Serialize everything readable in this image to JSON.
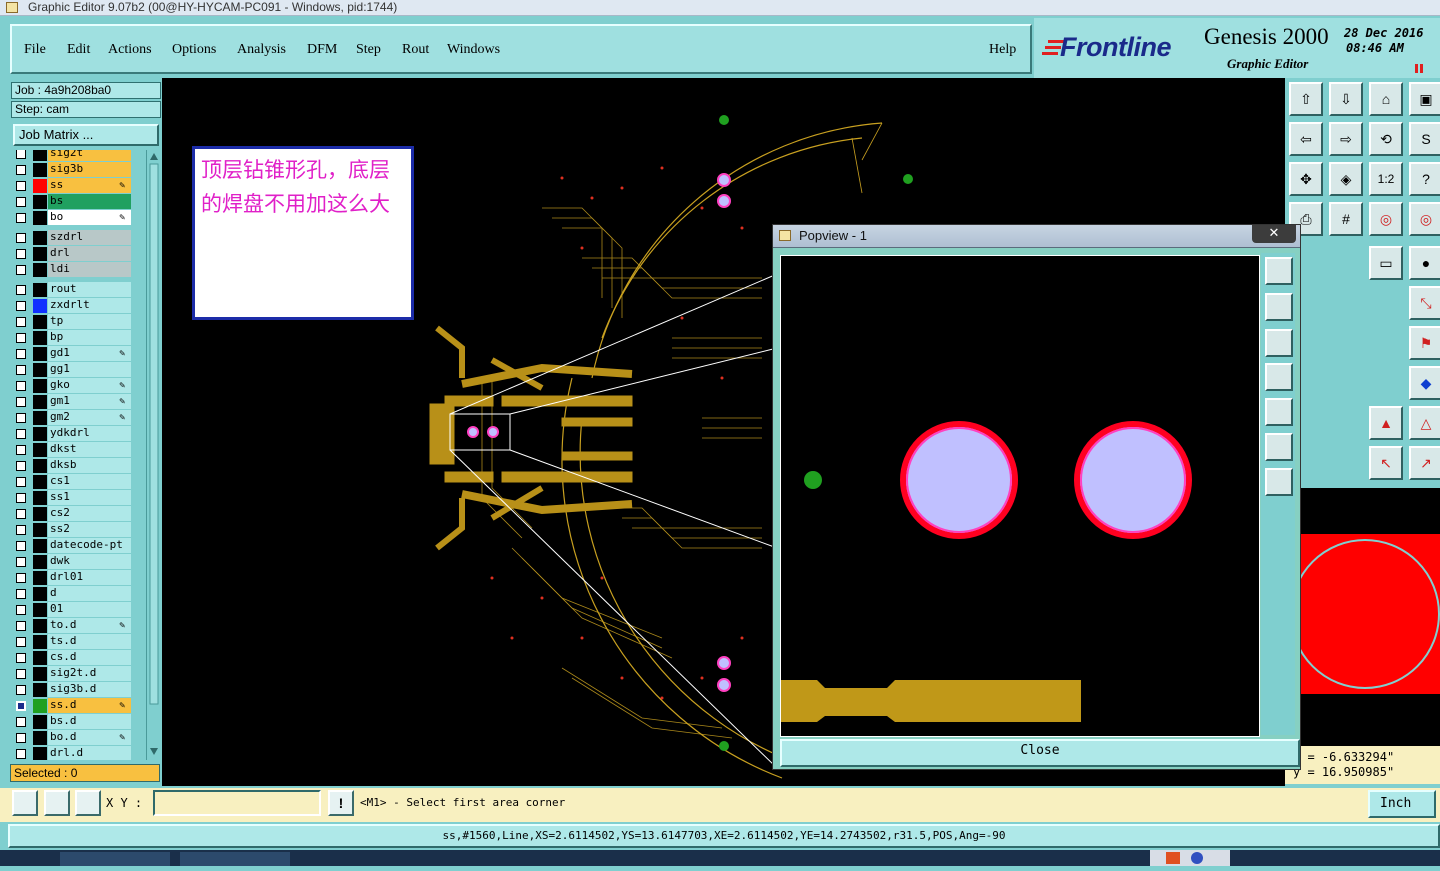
{
  "window": {
    "title": "Graphic Editor 9.07b2 (00@HY-HYCAM-PC091 - Windows, pid:1744)"
  },
  "menu": [
    "File",
    "Edit",
    "Actions",
    "Options",
    "Analysis",
    "DFM",
    "Step",
    "Rout",
    "Windows"
  ],
  "help_label": "Help",
  "brand": {
    "logo": "Frontline",
    "product": "Genesis 2000",
    "subtitle": "Graphic Editor",
    "date": "28 Dec 2016",
    "time": "08:46 AM"
  },
  "job": {
    "job_label": "Job : 4a9h208ba0",
    "step_label": "Step: cam",
    "matrix_button": "Job Matrix ..."
  },
  "layers": [
    {
      "name": "sig2t",
      "color": "#f8c040",
      "swatch": "#000000",
      "checked": false
    },
    {
      "name": "sig3b",
      "color": "#f8c040",
      "swatch": "#000000",
      "checked": false
    },
    {
      "name": "ss",
      "color": "#f8c040",
      "swatch": "#ff0000",
      "checked": false,
      "pen": true
    },
    {
      "name": "bs",
      "color": "#20a060",
      "swatch": "#000000",
      "checked": false
    },
    {
      "name": "bo",
      "color": "#ffffff",
      "swatch": "#000000",
      "checked": false,
      "pen": true
    },
    {
      "name": "szdrl",
      "color": "#b8c8c8",
      "swatch": "#000000",
      "checked": false,
      "gap": true
    },
    {
      "name": "drl",
      "color": "#b8c8c8",
      "swatch": "#000000",
      "checked": false
    },
    {
      "name": "ldi",
      "color": "#b8c8c8",
      "swatch": "#000000",
      "checked": false
    },
    {
      "name": "rout",
      "color": "#aee8e8",
      "swatch": "#000000",
      "checked": false,
      "gap": true
    },
    {
      "name": "zxdrlt",
      "color": "#aee8e8",
      "swatch": "#1030ff",
      "checked": false
    },
    {
      "name": "tp",
      "color": "#aee8e8",
      "swatch": "#000000",
      "checked": false
    },
    {
      "name": "bp",
      "color": "#aee8e8",
      "swatch": "#000000",
      "checked": false
    },
    {
      "name": "gd1",
      "color": "#aee8e8",
      "swatch": "#000000",
      "checked": false,
      "pen": true
    },
    {
      "name": "gg1",
      "color": "#aee8e8",
      "swatch": "#000000",
      "checked": false
    },
    {
      "name": "gko",
      "color": "#aee8e8",
      "swatch": "#000000",
      "checked": false,
      "pen": true
    },
    {
      "name": "gm1",
      "color": "#aee8e8",
      "swatch": "#000000",
      "checked": false,
      "pen": true
    },
    {
      "name": "gm2",
      "color": "#aee8e8",
      "swatch": "#000000",
      "checked": false,
      "pen": true
    },
    {
      "name": "ydkdrl",
      "color": "#aee8e8",
      "swatch": "#000000",
      "checked": false
    },
    {
      "name": "dkst",
      "color": "#aee8e8",
      "swatch": "#000000",
      "checked": false
    },
    {
      "name": "dksb",
      "color": "#aee8e8",
      "swatch": "#000000",
      "checked": false
    },
    {
      "name": "cs1",
      "color": "#aee8e8",
      "swatch": "#000000",
      "checked": false
    },
    {
      "name": "ss1",
      "color": "#aee8e8",
      "swatch": "#000000",
      "checked": false
    },
    {
      "name": "cs2",
      "color": "#aee8e8",
      "swatch": "#000000",
      "checked": false
    },
    {
      "name": "ss2",
      "color": "#aee8e8",
      "swatch": "#000000",
      "checked": false
    },
    {
      "name": "datecode-pt",
      "color": "#aee8e8",
      "swatch": "#000000",
      "checked": false
    },
    {
      "name": "dwk",
      "color": "#aee8e8",
      "swatch": "#000000",
      "checked": false
    },
    {
      "name": "drl01",
      "color": "#aee8e8",
      "swatch": "#000000",
      "checked": false
    },
    {
      "name": "d",
      "color": "#aee8e8",
      "swatch": "#000000",
      "checked": false
    },
    {
      "name": "01",
      "color": "#aee8e8",
      "swatch": "#000000",
      "checked": false
    },
    {
      "name": "to.d",
      "color": "#aee8e8",
      "swatch": "#000000",
      "checked": false,
      "pen": true
    },
    {
      "name": "ts.d",
      "color": "#aee8e8",
      "swatch": "#000000",
      "checked": false
    },
    {
      "name": "cs.d",
      "color": "#aee8e8",
      "swatch": "#000000",
      "checked": false
    },
    {
      "name": "sig2t.d",
      "color": "#aee8e8",
      "swatch": "#000000",
      "checked": false
    },
    {
      "name": "sig3b.d",
      "color": "#aee8e8",
      "swatch": "#000000",
      "checked": false
    },
    {
      "name": "ss.d",
      "color": "#f8c040",
      "swatch": "#20a020",
      "checked": true,
      "pen": true
    },
    {
      "name": "bs.d",
      "color": "#aee8e8",
      "swatch": "#000000",
      "checked": false
    },
    {
      "name": "bo.d",
      "color": "#aee8e8",
      "swatch": "#000000",
      "checked": false,
      "pen": true
    },
    {
      "name": "drl.d",
      "color": "#aee8e8",
      "swatch": "#000000",
      "checked": false
    }
  ],
  "selected_label": "Selected : 0",
  "annotation_text": "顶层钻锥形孔，底层的焊盘不用加这么大",
  "popview": {
    "title": "Popview - 1",
    "close_x": "✕",
    "close_button": "Close"
  },
  "coords": {
    "x": "= -6.633294\"",
    "y": "= 16.950985\""
  },
  "command": {
    "xy_label": "X Y :",
    "input_value": "",
    "prompt": "<M1> - Select first area corner",
    "units": "Inch"
  },
  "status_text": "ss,#1560,Line,XS=2.6114502,YS=13.6147703,XE=2.6114502,YE=14.2743502,r31.5,POS,Ang=-90",
  "toolbar_icons": [
    "zoom-home-icon",
    "zoom-out-icon",
    "home-icon",
    "fit-icon",
    "pan-left-icon",
    "pan-right-icon",
    "ratio-icon",
    "s-icon",
    "fit-view-icon",
    "center-icon",
    "one-to-one-icon",
    "help-icon",
    "print-icon",
    "grid-icon",
    "snap-icon",
    "snap-alt-icon"
  ]
}
